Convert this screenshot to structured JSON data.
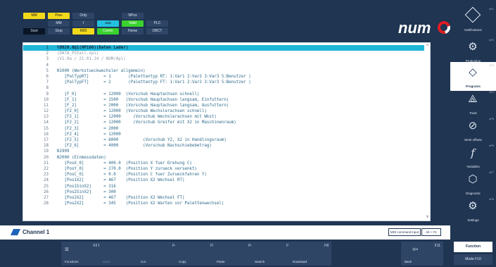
{
  "top_buttons": [
    {
      "id": "b1",
      "label": "MM",
      "style": "yellow"
    },
    {
      "id": "b2",
      "label": "Prev",
      "style": "yellow"
    },
    {
      "id": "b3",
      "label": "Only",
      "style": "dark"
    },
    {
      "id": "b4",
      "label": "NPos",
      "style": "dark"
    },
    {
      "id": "b5",
      "label": "MM",
      "style": "dark"
    },
    {
      "id": "b6",
      "label": "I",
      "style": "dark"
    },
    {
      "id": "b7",
      "label": "aaa",
      "style": "cyan"
    },
    {
      "id": "b8",
      "label": "Valid",
      "style": "green"
    },
    {
      "id": "b9",
      "label": "PLC",
      "style": "dark"
    },
    {
      "id": "b10",
      "label": "Start",
      "style": "black"
    },
    {
      "id": "b11",
      "label": "Stop",
      "style": "dark"
    },
    {
      "id": "b12",
      "label": "M00",
      "style": "yellow"
    },
    {
      "id": "b13",
      "label": "Comm",
      "style": "green"
    },
    {
      "id": "b14",
      "label": "Home",
      "style": "dark"
    },
    {
      "id": "b15",
      "label": "OBCT",
      "style": "dark"
    }
  ],
  "logo": {
    "text": "num"
  },
  "editor": {
    "lines": [
      {
        "n": "1",
        "t": "%9020.0@1(HP160)(Daten Lader)",
        "sel": true
      },
      {
        "n": "2",
        "t": "(DATA_PCEall.xpi)",
        "gray": true
      },
      {
        "n": "3",
        "t": "(V1.0a / 21.01.14 / NUM/Apl)",
        "gray": true
      },
      {
        "n": "4",
        "t": ""
      },
      {
        "n": "5",
        "t": "N1000 (Werkstueckwechsler allgemein)"
      },
      {
        "n": "6",
        "t": "   [PalTypRT]      = 1       (Palettentyp RT: 1:Var1 2:Var2 3:Var3 5:Benutzer )"
      },
      {
        "n": "7",
        "t": "   [PalTypFT]      = 2       (Palettentyp FT: 1:Var1 2:Var2 3:Var3 5:Benutzer )"
      },
      {
        "n": "8",
        "t": ""
      },
      {
        "n": "9",
        "t": "   [F_0]           = 12000  (Vorschub Hauptachsen schnell)"
      },
      {
        "n": "10",
        "t": "   [F_1]           = 1500   (Vorschub Hauptachsen langsam, Einfuttern)"
      },
      {
        "n": "11",
        "t": "   [F_2]           = 2000   (Vorschub Hauptachsen langsam, Ausfuttern)"
      },
      {
        "n": "12",
        "t": "   [F2_0]          = 12000  (Vorschub Wechslerachsen schnell)"
      },
      {
        "n": "13",
        "t": "   [F2_1]          = 12000     (Vorschub Wechslerachsen mit Wkst)"
      },
      {
        "n": "14",
        "t": "   [F2_2]          = 12000     (Vorschub Greifer mit X2 in Maschinenraum)"
      },
      {
        "n": "15",
        "t": "   [F2_3]          = 2000"
      },
      {
        "n": "16",
        "t": "   [F2_4]          = 12000"
      },
      {
        "n": "17",
        "t": "   [F2_5]          = 6000          (Vorschub Y2, X2 in Handlingsraum)"
      },
      {
        "n": "18",
        "t": "   [F2_6]          = 4000          (Vorschub Nachschiebebetrag)"
      },
      {
        "n": "19",
        "t": "N1999"
      },
      {
        "n": "20",
        "t": "N2000 (Einmessdaten)"
      },
      {
        "n": "21",
        "t": "   [PosX_0]        = 400.0  (Position X fuer Drehung C)"
      },
      {
        "n": "22",
        "t": "   [PosY_0]        = 270.0  (Position Y zurueck versenkt)"
      },
      {
        "n": "23",
        "t": "   [PosC_0]        = 0.0    (Position C fuer Zurueckfahren Y)"
      },
      {
        "n": "24",
        "t": "   [Pos1X2]        = 467    (Position X2 Wechsel RT)"
      },
      {
        "n": "25",
        "t": "   [Pos1SinX2]     = 316"
      },
      {
        "n": "26",
        "t": "   [Pos2SinX2]     = 300"
      },
      {
        "n": "27",
        "t": "   [Pos2X2]        = 467    (Position X2 Wechsel FT)"
      },
      {
        "n": "28",
        "t": "   [Pos2X2]        = 345    (Position X2 Warten vor Palettenwechsel)"
      }
    ]
  },
  "channel": {
    "label": "Channel 1",
    "mdi_label": "MDI command input",
    "mdi_key": "Alt + F2"
  },
  "fkeys": [
    {
      "num": "F2 B",
      "label": "Functions",
      "icon": "≡",
      "dim": false
    },
    {
      "num": "",
      "label": "Save",
      "icon": "",
      "dim": true
    },
    {
      "num": "F4",
      "label": "Cut",
      "icon": "",
      "dim": false
    },
    {
      "num": "F5",
      "label": "Copy",
      "icon": "",
      "dim": false
    },
    {
      "num": "F6",
      "label": "Paste",
      "icon": "",
      "dim": false
    },
    {
      "num": "F7",
      "label": "Search",
      "icon": "",
      "dim": false
    },
    {
      "num": "F8",
      "label": "Download",
      "icon": "",
      "dim": false
    },
    {
      "num": "F11",
      "label": "Back",
      "icon": "⇦",
      "dim": false
    }
  ],
  "side": [
    {
      "num": "sF1",
      "label": "Notifications",
      "icon": "",
      "active": false
    },
    {
      "num": "sF2",
      "label": "Production",
      "icon": "⚙",
      "active": false
    },
    {
      "num": "sF3",
      "label": "Programs",
      "icon": "◇",
      "active": true
    },
    {
      "num": "sF4",
      "label": "Tools",
      "icon": "⟁",
      "active": false
    },
    {
      "num": "sF5",
      "label": "Work offsets",
      "icon": "⊘",
      "active": false
    },
    {
      "num": "sF6",
      "label": "Variables",
      "icon": "f",
      "active": false
    },
    {
      "num": "sF7",
      "label": "Diagnostic",
      "icon": "⬡",
      "active": false
    },
    {
      "num": "sF8",
      "label": "Settings",
      "icon": "⚙",
      "active": false
    }
  ],
  "right_buttons": {
    "function": "Function",
    "mode": "Mode F10"
  }
}
